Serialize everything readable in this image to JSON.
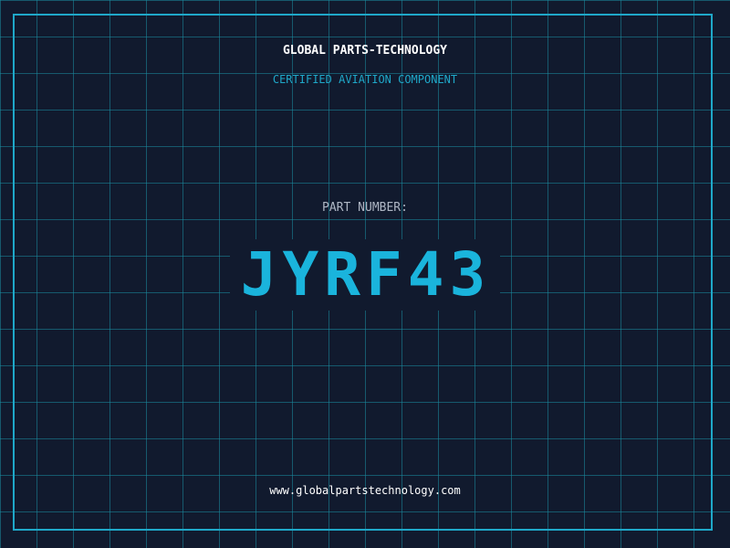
{
  "header": {
    "brand": "GLOBAL PARTS-TECHNOLOGY",
    "tagline": "CERTIFIED AVIATION COMPONENT"
  },
  "part": {
    "label": "PART NUMBER:",
    "number": "JYRF43"
  },
  "footer": {
    "url": "www.globalpartstechnology.com"
  },
  "colors": {
    "background": "#111a2e",
    "grid": "#198ca0",
    "frame": "#1fa8c9",
    "accent": "#1ab4dc",
    "label": "#aeb6c4",
    "text": "#ffffff"
  }
}
